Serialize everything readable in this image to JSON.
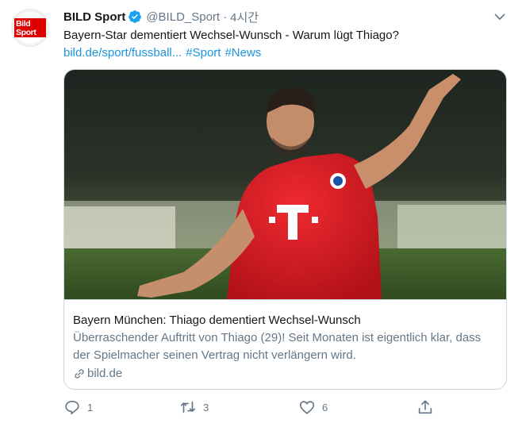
{
  "account": {
    "avatar_logo_text": "Bild Sport",
    "name": "BILD Sport",
    "handle": "@BILD_Sport",
    "separator": "·",
    "time": "4시간",
    "verified": true
  },
  "tweet": {
    "text": "Bayern-Star dementiert Wechsel-Wunsch - Warum lügt Thiago?",
    "link": "bild.de/sport/fussball...",
    "hashtags": [
      "#Sport",
      "#News"
    ]
  },
  "card": {
    "title": "Bayern München: Thiago dementiert Wechsel-Wunsch",
    "description": "Überraschender Auftritt von Thiago (29)! Seit Monaten ist eigentlich klar, dass der Spielmacher seinen Vertrag nicht verlängern wird.",
    "domain": "bild.de"
  },
  "actions": {
    "reply_count": "1",
    "retweet_count": "3",
    "like_count": "6"
  },
  "icons": {
    "verified": "verified-badge-icon",
    "menu": "chevron-down-icon",
    "link": "link-icon",
    "reply": "reply-icon",
    "retweet": "retweet-icon",
    "like": "heart-icon",
    "share": "share-icon"
  },
  "colors": {
    "accent": "#1b95e0",
    "text": "#14171a",
    "secondary": "#657786",
    "border": "#ccd6dd",
    "brand_red": "#dd0000"
  }
}
